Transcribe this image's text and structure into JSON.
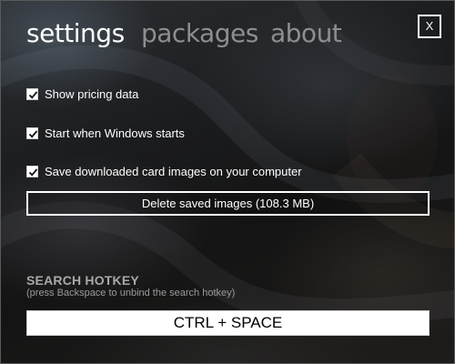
{
  "tabs": {
    "settings": "settings",
    "packages": "packages",
    "about": "about"
  },
  "window": {
    "close_label": "X"
  },
  "options": [
    {
      "label": "Show pricing data",
      "checked": true
    },
    {
      "label": "Start when Windows starts",
      "checked": true
    },
    {
      "label": "Save downloaded card images on your computer",
      "checked": true
    }
  ],
  "delete_button": {
    "label": "Delete saved images (108.3 MB)"
  },
  "hotkey": {
    "heading": "SEARCH HOTKEY",
    "hint": "(press Backspace to unbind the search hotkey)",
    "value": "CTRL + SPACE"
  },
  "colors": {
    "active_tab": "#ffffff",
    "inactive_tab": "#8e8e8e",
    "text": "#ffffff",
    "heading": "#a9a9a9"
  }
}
